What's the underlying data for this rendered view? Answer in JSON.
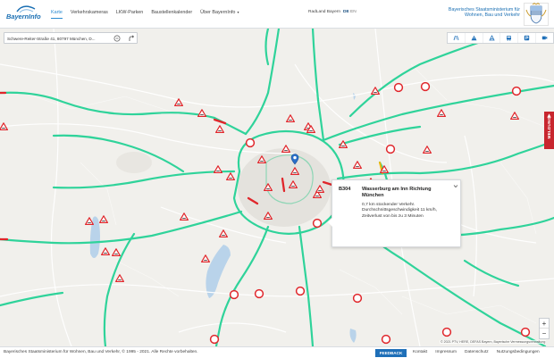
{
  "header": {
    "logo_text": "BayernInfo",
    "nav": [
      {
        "label": "Karte",
        "active": true
      },
      {
        "label": "Verkehrskameras",
        "active": false
      },
      {
        "label": "LKW-Parken",
        "active": false
      },
      {
        "label": "Baustellenkalender",
        "active": false
      },
      {
        "label": "Über BayernInfo",
        "active": false
      }
    ],
    "radl_label": "RadLand Bayern",
    "lang_de": "DE",
    "lang_en": "EN",
    "ministry_line1": "Bayerisches Staatsministerium für",
    "ministry_line2": "Wohnen, Bau und Verkehr"
  },
  "search": {
    "value": "Schwere-Reiter-Straße 41, 80797 München, D..."
  },
  "layers": [
    "road-icon",
    "warning-icon",
    "construction-icon",
    "bus-icon",
    "parking-icon",
    "camera-icon"
  ],
  "popup": {
    "road": "B304",
    "title": "Wasserburg am Inn Richtung München",
    "line1": "0,7 km stockender Verkehr.",
    "line2": "Durchschnittsgeschwindigkeit 11 km/h,",
    "line3": "Zeitverlust von bis zu 3 Minuten"
  },
  "side_tab": "MELDUNG",
  "zoom": {
    "plus": "+",
    "minus": "−"
  },
  "attribution": "© 2021 PTV, HERE, DEFAS Bayern, Bayerische Vermessungsverwaltung",
  "footer": {
    "copyright": "Bayerisches Staatsministerium für Wohnen, Bau und Verkehr, © 1995 - 2021. Alle Rechte vorbehalten.",
    "feedback": "FEEDBACK",
    "links": [
      "Kontakt",
      "Impressum",
      "Datenschutz",
      "Nutzungsbedingungen"
    ]
  },
  "colors": {
    "accent": "#1e6fb8",
    "traffic_free": "#2fd39a",
    "traffic_jam": "#e0262b",
    "warning_red": "#e0262b"
  },
  "icons": {
    "warning": "warning-triangle-icon",
    "closure": "closure-circle-icon",
    "location": "location-pin-icon"
  }
}
